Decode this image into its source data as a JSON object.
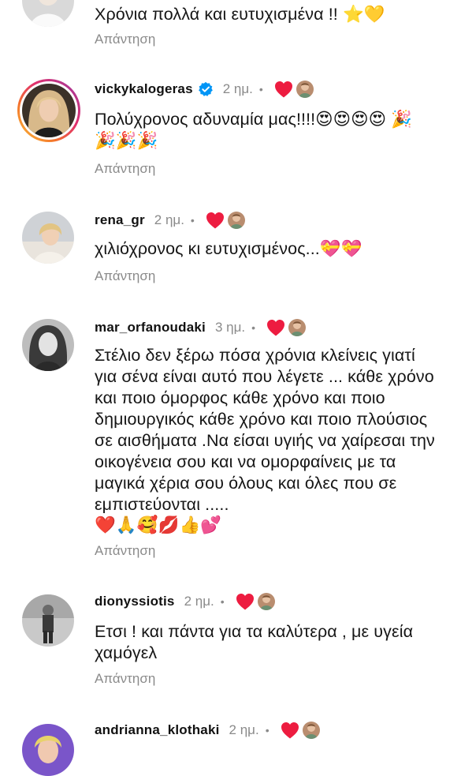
{
  "reply_label": "Απάντηση",
  "colors": {
    "heart": "#ed1c40",
    "verified": "#0095f6",
    "meta_gray": "#8a8a8a"
  },
  "icons": {
    "like": "heart-icon",
    "verified": "verified-badge-icon"
  },
  "comments": [
    {
      "username": "",
      "time": "",
      "text": "Χρόνια πολλά και ευτυχισμένα !! ⭐💛"
    },
    {
      "username": "vickykalogeras",
      "verified": true,
      "time": "2 ημ.",
      "text": "Πολύχρονος αδυναμία μας!!!!😍😍😍😍 🎉🎉🎉🎉"
    },
    {
      "username": "rena_gr",
      "time": "2 ημ.",
      "text": "χιλιόχρονος κι ευτυχισμένος...💝💝"
    },
    {
      "username": "mar_orfanoudaki",
      "time": "3 ημ.",
      "text": "Στέλιο δεν ξέρω πόσα χρόνια κλείνεις γιατί για σένα είναι αυτό που λέγετε ... κάθε χρόνο και ποιο όμορφος κάθε χρόνο και ποιο δημιουργικός κάθε χρόνο και ποιο πλούσιος σε αισθήματα .Να είσαι υγιής να χαίρεσαι την οικογένεια σου και να ομορφαίνεις με τα μαγικά χέρια σου όλους και όλες που σε εμπιστεύονται .....",
      "emoji_line": "❤️🙏🥰💋👍💕"
    },
    {
      "username": "dionyssiotis",
      "time": "2 ημ.",
      "text": "Ετσι ! και πάντα για τα καλύτερα , με υγεία χαμόγελ"
    },
    {
      "username": "andrianna_klothaki",
      "time": "2 ημ.",
      "text": ""
    }
  ]
}
